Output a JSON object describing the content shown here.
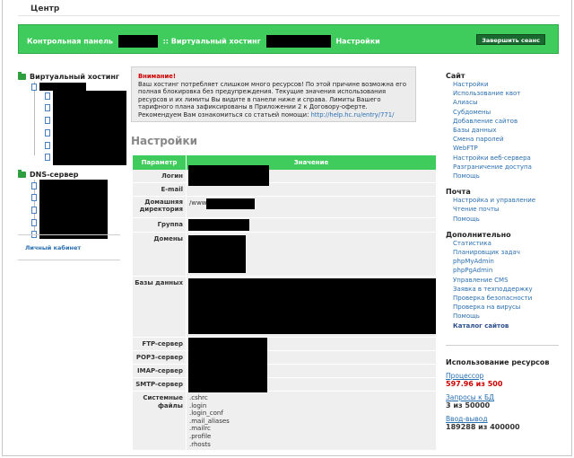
{
  "brand": "Центр",
  "topbar": {
    "crumb_panel": "Контрольная панель",
    "crumb_sep1": ":: Виртуальный хостинг",
    "crumb_settings": "Настройки",
    "exit_label": "Завершить сеанс"
  },
  "left": {
    "hosting_title": "Виртуальный хостинг",
    "dns_title": "DNS-сервер",
    "cabinet_link": "Личный кабинет"
  },
  "notice": {
    "warn": "Внимание!",
    "text": "Ваш хостинг потребляет слишком много ресурсов! По этой причине возможна его полная блокировка без предупреждения. Текущие значения использования ресурсов и их лимиты Вы видите в панели ниже и справа. Лимиты Вашего тарифного плана зафиксированы в Приложении 2 к Договору-оферте. Рекомендуем Вам ознакомиться со статьей помощи:",
    "link": "http://help.hc.ru/entry/771/"
  },
  "page_title": "Настройки",
  "table": {
    "col_param": "Параметр",
    "col_value": "Значение",
    "login": "Логин",
    "email": "E-mail",
    "home": "Домашняя директория",
    "home_value": "/www",
    "group": "Группа",
    "domains": "Домены",
    "databases": "Базы данных",
    "ftp": "FTP-сервер",
    "pop3": "POP3-сервер",
    "imap": "IMAP-сервер",
    "smtp": "SMTP-сервер",
    "sysfiles": "Системные файлы",
    "files": [
      ".cshrc",
      ".login",
      ".login_conf",
      ".mail_aliases",
      ".mailrc",
      ".profile",
      ".rhosts"
    ]
  },
  "right": {
    "site_title": "Сайт",
    "site_links": [
      "Настройки",
      "Использование квот",
      "Алиасы",
      "Субдомены",
      "Добавление сайтов",
      "Базы данных",
      "Смена паролей",
      "WebFTP",
      "Настройки веб-сервера",
      "Разграничение доступа",
      "Помощь"
    ],
    "mail_title": "Почта",
    "mail_links": [
      "Настройка и управление",
      "Чтение почты",
      "Помощь"
    ],
    "extra_title": "Дополнительно",
    "extra_links": [
      "Статистика",
      "Планировщик задач",
      "phpMyAdmin",
      "phpPgAdmin",
      "Управление CMS",
      "Заявка в техподдержку",
      "Проверка безопасности",
      "Проверка на вирусы",
      "Помощь"
    ],
    "catalog_link": "Каталог сайтов"
  },
  "usage": {
    "title": "Использование ресурсов",
    "cpu_label": "Процессор",
    "cpu_value": "597.96 из 500",
    "db_label": "Запросы к БД",
    "db_value": "3 из 50000",
    "io_label": "Ввод-вывод",
    "io_value": "189288 из 400000"
  },
  "colors": {
    "accent": "#3fcc5c",
    "link": "#2a6fb0",
    "warn": "#cc0000"
  }
}
